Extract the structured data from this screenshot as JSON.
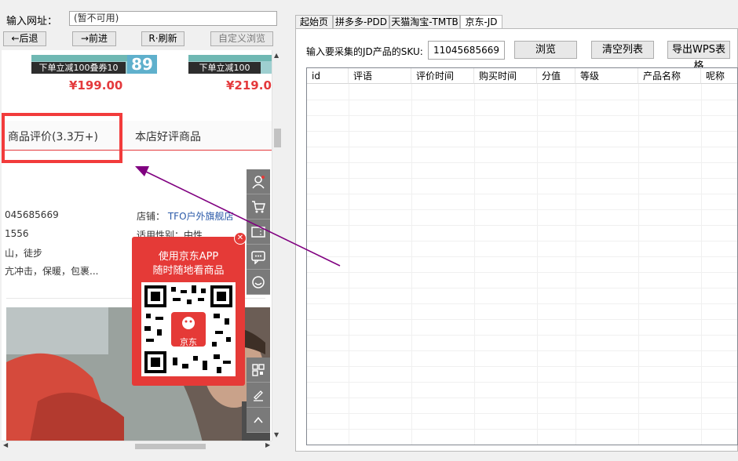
{
  "browser": {
    "url_label": "输入网址：",
    "url_value": "(暂不可用)",
    "back_label": "←后退",
    "forward_label": "→前进",
    "refresh_label": "R·刷新",
    "custom_browse_label": "自定义浏览"
  },
  "page": {
    "products": [
      {
        "promo_text": "下单立减100叠券10",
        "promo_big": "89",
        "price": "¥199.00"
      },
      {
        "promo_text": "下单立减100",
        "price": "¥219.0"
      }
    ],
    "tabs": {
      "reviews": "商品评价(3.3万+)",
      "shop_good": "本店好评商品"
    },
    "info": {
      "sku_partial": "045685669",
      "shop_label": "店铺：",
      "shop_name": "TFO户外旗舰店",
      "line2_partial": "1556",
      "gender_label": "适用性别：中性",
      "line3_partial": "山，徒步",
      "line4_partial": "亢冲击，保暖，包裹..."
    },
    "qr_popup": {
      "line1": "使用京东APP",
      "line2": "随时随地看商品",
      "logo_text": "京东"
    }
  },
  "icons": [
    "user-icon",
    "cart-icon",
    "coupon-icon",
    "message-icon",
    "service-icon",
    "qr-icon",
    "edit-icon",
    "up-icon"
  ],
  "tool": {
    "tabs": [
      "起始页",
      "拼多多-PDD",
      "天猫淘宝-TMTB",
      "京东-JD"
    ],
    "active_tab": "京东-JD",
    "sku_label": "输入要采集的JD产品的SKU:",
    "sku_value": "11045685669",
    "browse_label": "浏览",
    "clear_label": "清空列表",
    "export_label": "导出WPS表格",
    "columns": [
      "id",
      "评语",
      "评价时间",
      "购买时间",
      "分值",
      "等级",
      "产品名称",
      "呢称"
    ]
  },
  "colors": {
    "highlight": "#f23b3b",
    "arrow": "#800080",
    "jd_red": "#e53a37",
    "price_red": "#e4393c"
  }
}
